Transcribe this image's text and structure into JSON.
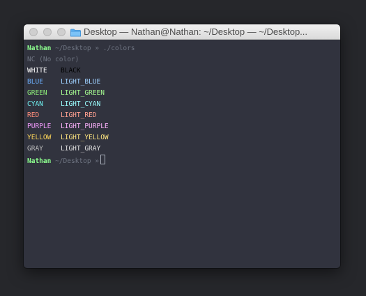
{
  "window": {
    "title": "Desktop — Nathan@Nathan: ~/Desktop — ~/Desktop..."
  },
  "icons": {
    "folder": "folder-icon"
  },
  "terminal": {
    "prompt_user": "Nathan",
    "prompt_path": "~/Desktop",
    "prompt_symbol": "»",
    "command": "./colors",
    "nc_line": "NC (No color)",
    "rows": [
      {
        "left": "WHITE",
        "left_color": "#ffffff",
        "right": "BLACK",
        "right_color": "#000000"
      },
      {
        "left": "BLUE",
        "left_color": "#6cb0ff",
        "right": "LIGHT_BLUE",
        "right_color": "#9ed0ff"
      },
      {
        "left": "GREEN",
        "left_color": "#8ff07a",
        "right": "LIGHT_GREEN",
        "right_color": "#a8ff92"
      },
      {
        "left": "CYAN",
        "left_color": "#6ff0f0",
        "right": "LIGHT_CYAN",
        "right_color": "#9bffff"
      },
      {
        "left": "RED",
        "left_color": "#ff8c7a",
        "right": "LIGHT_RED",
        "right_color": "#ffa090"
      },
      {
        "left": "PURPLE",
        "left_color": "#f59cff",
        "right": "LIGHT_PURPLE",
        "right_color": "#ffb3ff"
      },
      {
        "left": "YELLOW",
        "left_color": "#ffd75a",
        "right": "LIGHT_YELLOW",
        "right_color": "#ffe680"
      },
      {
        "left": "GRAY",
        "left_color": "#bdbdbd",
        "right": "LIGHT_GRAY",
        "right_color": "#e2e2e2"
      }
    ]
  }
}
